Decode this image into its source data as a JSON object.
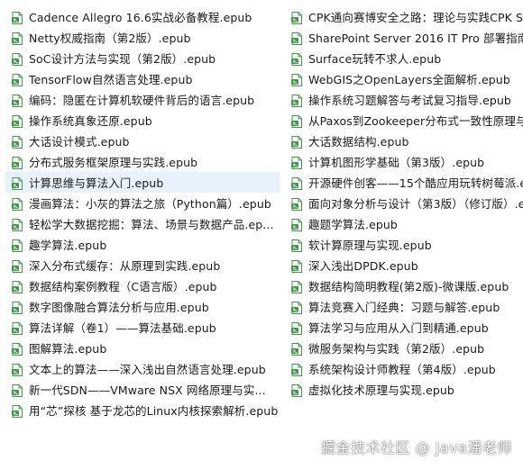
{
  "icon": "epub-file-icon",
  "colors": {
    "icon_green": "#3e9a47",
    "selected_bg": "#e8f2fc",
    "text": "#1a1a1a"
  },
  "left_files": [
    "Cadence Allegro 16.6实战必备教程.epub",
    "Netty权威指南（第2版）.epub",
    "SoC设计方法与实现（第2版）.epub",
    "TensorFlow自然语言处理.epub",
    "编码：隐匿在计算机软硬件背后的语言.epub",
    "操作系统真象还原.epub",
    "大话设计模式.epub",
    "分布式服务框架原理与实践.epub",
    "计算思维与算法入门.epub",
    "漫画算法：小灰的算法之旅（Python篇）.epub",
    "轻松学大数据挖掘：算法、场景与数据产品.ep...",
    "趣学算法.epub",
    "深入分布式缓存：从原理到实践.epub",
    "数据结构案例教程（C语言版）.epub",
    "数字图像融合算法分析与应用.epub",
    "算法详解（卷1）——算法基础.epub",
    "图解算法.epub",
    "文本上的算法——深入浅出自然语言处理.epub",
    "新一代SDN——VMware NSX 网络原理与实...",
    "用“芯”探核 基于龙芯的Linux内核探索解析.epub"
  ],
  "right_files": [
    "CPK通向赛博安全之路：理论与实践CPK Solu",
    "SharePoint Server 2016 IT Pro 部署指南.epub",
    "Surface玩转不求人.epub",
    "WebGIS之OpenLayers全面解析.epub",
    "操作系统习题解答与考试复习指导.epub",
    "从Paxos到Zookeeper分布式一致性原理与实",
    "大话数据结构.epub",
    "计算机图形学基础（第3版）.epub",
    "开源硬件创客——15个酷应用玩转树莓派.epub",
    "面向对象分析与设计（第3版）（修订版）.epub",
    "趣题学算法.epub",
    "软计算原理与实现.epub",
    "深入浅出DPDK.epub",
    "数据结构简明教程(第2版)-微课版.epub",
    "算法竞赛入门经典：习题与解答.epub",
    "算法学习与应用从入门到精通.epub",
    "微服务架构与实践（第2版）.epub",
    "系统架构设计师教程（第4版）.epub",
    "虚拟化技术原理与实现.epub"
  ],
  "selected_index_left": 8,
  "watermark": "掘金技术社区 @ Java潘老师"
}
